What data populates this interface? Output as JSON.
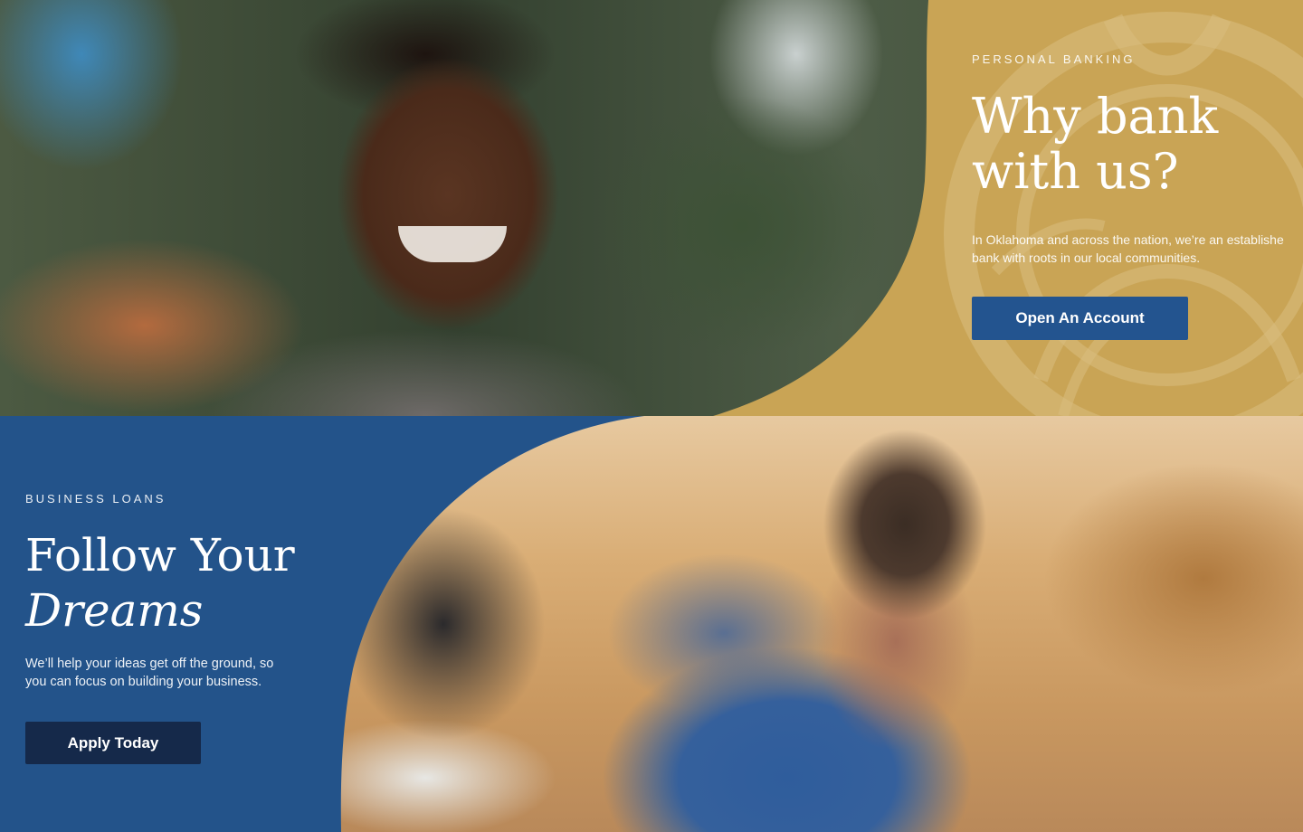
{
  "personal_banking": {
    "eyebrow": "PERSONAL BANKING",
    "headline_line1": "Why bank",
    "headline_line2": "with us?",
    "description_line1": "In Oklahoma and across the nation, we’re an establishe",
    "description_line2": "bank with roots in our local communities.",
    "cta_label": "Open An Account",
    "panel_color": "#c9a455",
    "cta_color": "#23548f"
  },
  "business_loans": {
    "eyebrow": "BUSINESS LOANS",
    "headline_line1": "Follow Your",
    "headline_line2": "Dreams",
    "description_line1": "We’ll help your ideas get off the ground, so",
    "description_line2": "you can focus on building your business.",
    "cta_label": "Apply Today",
    "panel_color": "#23538a",
    "cta_color": "#15294a"
  },
  "images": {
    "top": "portrait-photo",
    "bottom": "workshop-photo"
  }
}
